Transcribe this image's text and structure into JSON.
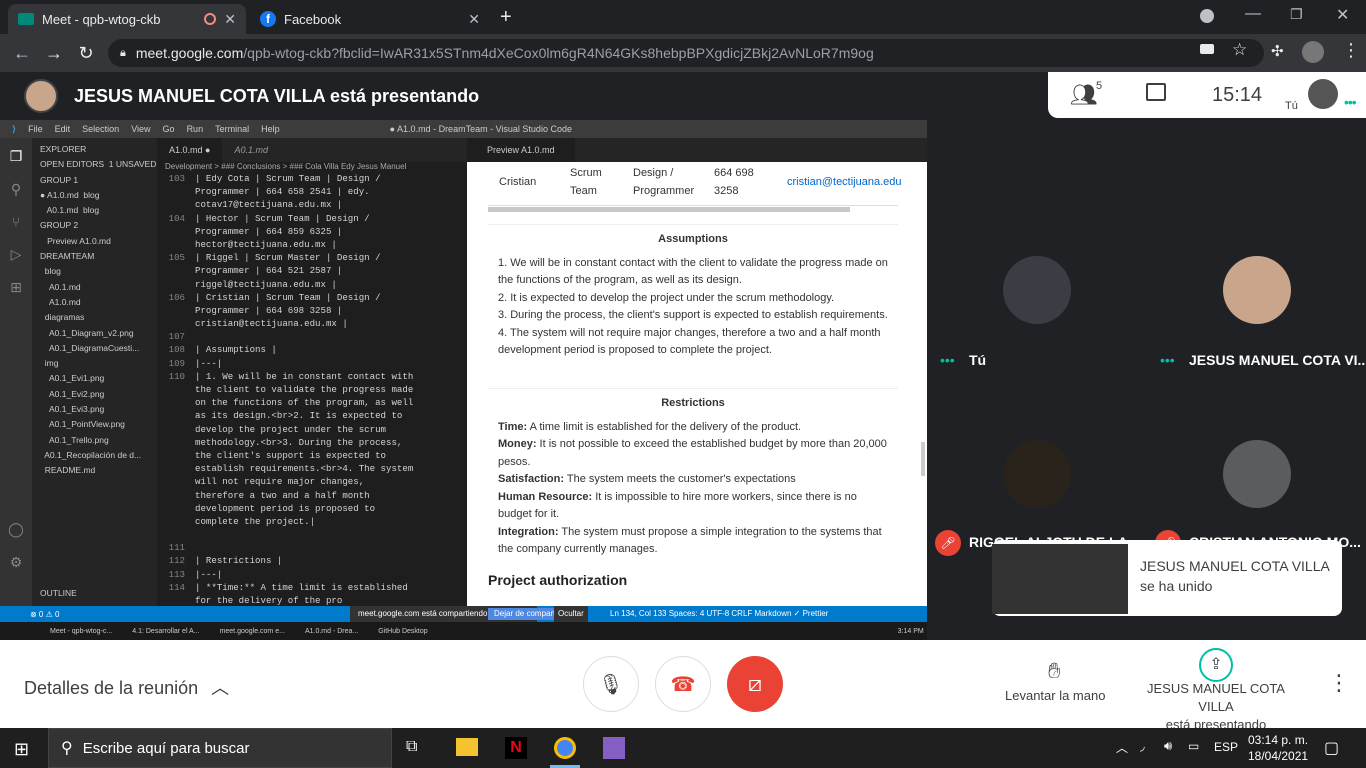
{
  "browser": {
    "tabs": [
      {
        "label": "Meet - qpb-wtog-ckb",
        "active": true
      },
      {
        "label": "Facebook",
        "active": false
      }
    ],
    "url_host": "meet.google.com",
    "url_path": "/qpb-wtog-ckb?fbclid=IwAR31x5STnm4dXeCox0lm6gR4N64GKs8hebpBPXgdicjZBkj2AvNLoR7m9og"
  },
  "meet": {
    "presenting_banner": "JESUS MANUEL COTA VILLA está presentando",
    "participant_count": "5",
    "clock": "15:14",
    "self_label": "Tú",
    "participants": [
      {
        "name": "Tú"
      },
      {
        "name": "JESUS MANUEL COTA VI..."
      },
      {
        "name": "RIGGEL ALJOTU DE LA..."
      },
      {
        "name": "CRISTIAN ANTONIO MO..."
      }
    ],
    "toast": {
      "line1": "JESUS MANUEL COTA VILLA",
      "line2": "se ha unido"
    },
    "bottom": {
      "details_label": "Detalles de la reunión",
      "raise_hand_label": "Levantar la mano",
      "presenting_line1": "JESUS MANUEL COTA VILLA",
      "presenting_line2": "está presentando"
    }
  },
  "vscode": {
    "menu": [
      "File",
      "Edit",
      "Selection",
      "View",
      "Go",
      "Run",
      "Terminal",
      "Help"
    ],
    "window_title": "● A1.0.md - DreamTeam - Visual Studio Code",
    "explorer_lines": [
      "EXPLORER",
      "OPEN EDITORS  1 UNSAVED",
      "GROUP 1",
      "● A1.0.md  blog",
      "   A0.1.md  blog",
      "GROUP 2",
      "   Preview A1.0.md",
      "DREAMTEAM",
      "  blog",
      "    A0.1.md",
      "    A1.0.md",
      "  diagramas",
      "    A0.1_Diagram_v2.png",
      "    A0.1_DiagramaCuesti...",
      "  img",
      "    A0.1_Evi1.png",
      "    A0.1_Evi2.png",
      "    A0.1_Evi3.png",
      "    A0.1_PointView.png",
      "    A0.1_Trello.png",
      "  A0.1_Recopilación de d...",
      "  README.md",
      "",
      "",
      "",
      "",
      "",
      "",
      "",
      "OUTLINE"
    ],
    "editor_tabs": [
      "A1.0.md  ●",
      "A0.1.md"
    ],
    "preview_tab": "Preview A1.0.md",
    "breadcrumb": "Development > ### Conclusions > ### Cola Villa Edy Jesus Manuel",
    "code_lines": [
      {
        "n": "103",
        "t": "| Edy Cota | Scrum Team | Design /"
      },
      {
        "n": "",
        "t": "Programmer | 664 658 2541 | edy."
      },
      {
        "n": "",
        "t": "cotav17@tectijuana.edu.mx |"
      },
      {
        "n": "104",
        "t": "| Hector | Scrum Team | Design /"
      },
      {
        "n": "",
        "t": "Programmer | 664 859 6325 |"
      },
      {
        "n": "",
        "t": "hector@tectijuana.edu.mx |"
      },
      {
        "n": "105",
        "t": "| Riggel | Scrum Master | Design /"
      },
      {
        "n": "",
        "t": "Programmer | 664 521 2587 |"
      },
      {
        "n": "",
        "t": "riggel@tectijuana.edu.mx |"
      },
      {
        "n": "106",
        "t": "| Cristian | Scrum Team | Design /"
      },
      {
        "n": "",
        "t": "Programmer | 664 698 3258 |"
      },
      {
        "n": "",
        "t": "cristian@tectijuana.edu.mx |"
      },
      {
        "n": "107",
        "t": ""
      },
      {
        "n": "108",
        "t": "| Assumptions |"
      },
      {
        "n": "109",
        "t": "|---|"
      },
      {
        "n": "110",
        "t": "| 1. We will be in constant contact with"
      },
      {
        "n": "",
        "t": "the client to validate the progress made"
      },
      {
        "n": "",
        "t": "on the functions of the program, as well"
      },
      {
        "n": "",
        "t": "as its design.<br>2. It is expected to"
      },
      {
        "n": "",
        "t": "develop the project under the scrum"
      },
      {
        "n": "",
        "t": "methodology.<br>3. During the process,"
      },
      {
        "n": "",
        "t": "the client's support is expected to"
      },
      {
        "n": "",
        "t": "establish requirements.<br>4. The system"
      },
      {
        "n": "",
        "t": "will not require major changes,"
      },
      {
        "n": "",
        "t": "therefore a two and a half month"
      },
      {
        "n": "",
        "t": "development period is proposed to"
      },
      {
        "n": "",
        "t": "complete the project.|"
      },
      {
        "n": "",
        "t": ""
      },
      {
        "n": "111",
        "t": ""
      },
      {
        "n": "112",
        "t": "| Restrictions |"
      },
      {
        "n": "113",
        "t": "|---|"
      },
      {
        "n": "114",
        "t": "| **Time:** A time limit is established"
      },
      {
        "n": "",
        "t": "for the delivery of the pro"
      }
    ],
    "preview": {
      "row_name": "Cristian",
      "row_role1": "Scrum",
      "row_role2": "Team",
      "row_design1": "Design /",
      "row_design2": "Programmer",
      "row_phone1": "664 698",
      "row_phone2": "3258",
      "row_email": "cristian@tectijuana.edu",
      "assumptions_title": "Assumptions",
      "assumptions": [
        "1. We will be in constant contact with the client to validate the progress made on the functions of the program, as well as its design.",
        "2. It is expected to develop the project under the scrum methodology.",
        "3. During the process, the client's support is expected to establish requirements.",
        "4. The system will not require major changes, therefore a two and a half month development period is proposed to complete the project."
      ],
      "restrictions_title": "Restrictions",
      "restrictions": [
        {
          "k": "Time:",
          "v": " A time limit is established for the delivery of the product."
        },
        {
          "k": "Money:",
          "v": " It is not possible to exceed the established budget by more than 20,000 pesos."
        },
        {
          "k": "Satisfaction:",
          "v": " The system meets the customer's expectations"
        },
        {
          "k": "Human Resource:",
          "v": " It is impossible to hire more workers, since there is no budget for it."
        },
        {
          "k": "Integration:",
          "v": " The system must propose a simple integration to the systems that the company currently manages."
        }
      ],
      "next_heading": "Project authorization"
    },
    "status_left": "⊗ 0  ⚠ 0",
    "status_right": "Ln 134, Col 133   Spaces: 4   UTF-8   CRLF   Markdown   ✓ Prettier",
    "share_notice": "meet.google.com está compartiendo tu pantalla.",
    "share_stop": "Dejar de compartir",
    "share_hide": "Ocultar",
    "small_taskbar_items": [
      "Meet - qpb-wtog-c...",
      "4.1: Desarrollar el A...",
      "meet.google.com e...",
      "A1.0.md - Drea...",
      "GitHub Desktop"
    ],
    "small_clock": "3:14 PM"
  },
  "taskbar": {
    "search_placeholder": "Escribe aquí para buscar",
    "lang": "ESP",
    "time": "03:14 p. m.",
    "date": "18/04/2021"
  },
  "colors": {
    "meet_bg": "#202124",
    "end_call_red": "#ea4335",
    "vscode_blue": "#007acc",
    "meet_teal": "#00bfa5"
  }
}
